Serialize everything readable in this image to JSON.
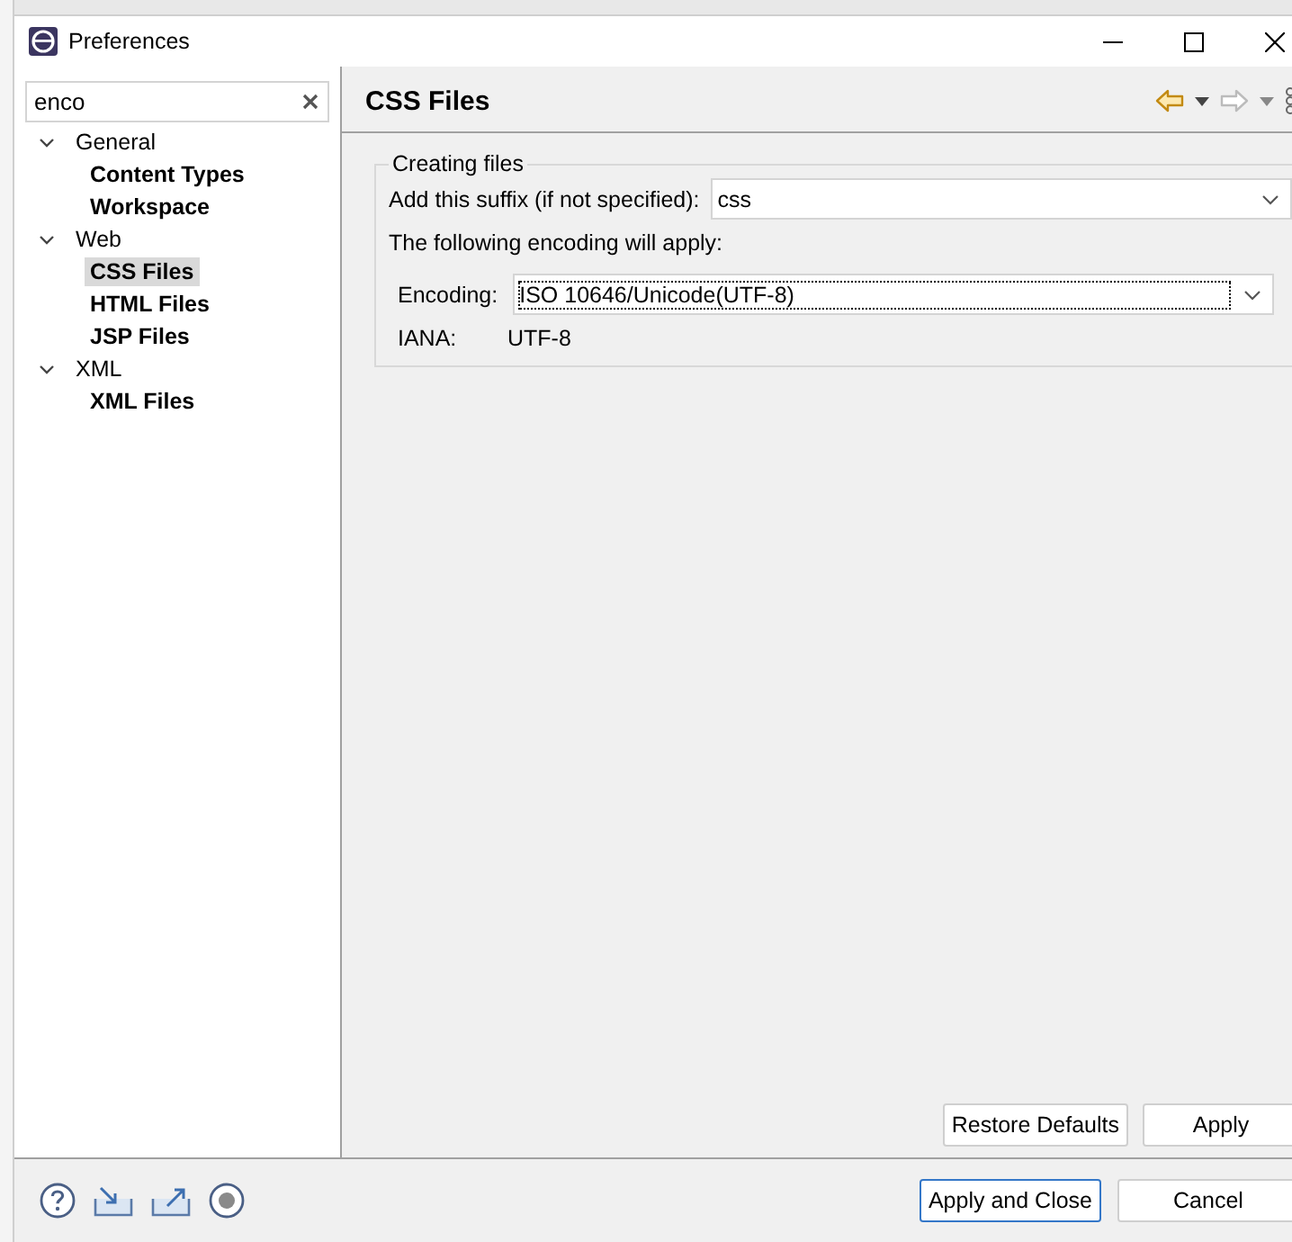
{
  "window": {
    "title": "Preferences"
  },
  "filter": {
    "value": "enco"
  },
  "tree": [
    {
      "label": "General",
      "expanded": true,
      "selected": false,
      "children": [
        {
          "label": "Content Types",
          "selected": false
        },
        {
          "label": "Workspace",
          "selected": false
        }
      ]
    },
    {
      "label": "Web",
      "expanded": true,
      "selected": false,
      "children": [
        {
          "label": "CSS Files",
          "selected": true
        },
        {
          "label": "HTML Files",
          "selected": false
        },
        {
          "label": "JSP Files",
          "selected": false
        }
      ]
    },
    {
      "label": "XML",
      "expanded": true,
      "selected": false,
      "children": [
        {
          "label": "XML Files",
          "selected": false
        }
      ]
    }
  ],
  "page": {
    "title": "CSS Files",
    "group": {
      "title": "Creating files",
      "suffix_label": "Add this suffix (if not specified):",
      "suffix_value": "css",
      "encoding_note": "The following encoding will apply:",
      "encoding_label": "Encoding:",
      "encoding_value": "ISO 10646/Unicode(UTF-8)",
      "iana_label": "IANA:",
      "iana_value": "UTF-8"
    },
    "buttons": [
      "Restore Defaults",
      "Apply"
    ]
  },
  "footer_buttons": [
    "Apply and Close",
    "Cancel"
  ]
}
